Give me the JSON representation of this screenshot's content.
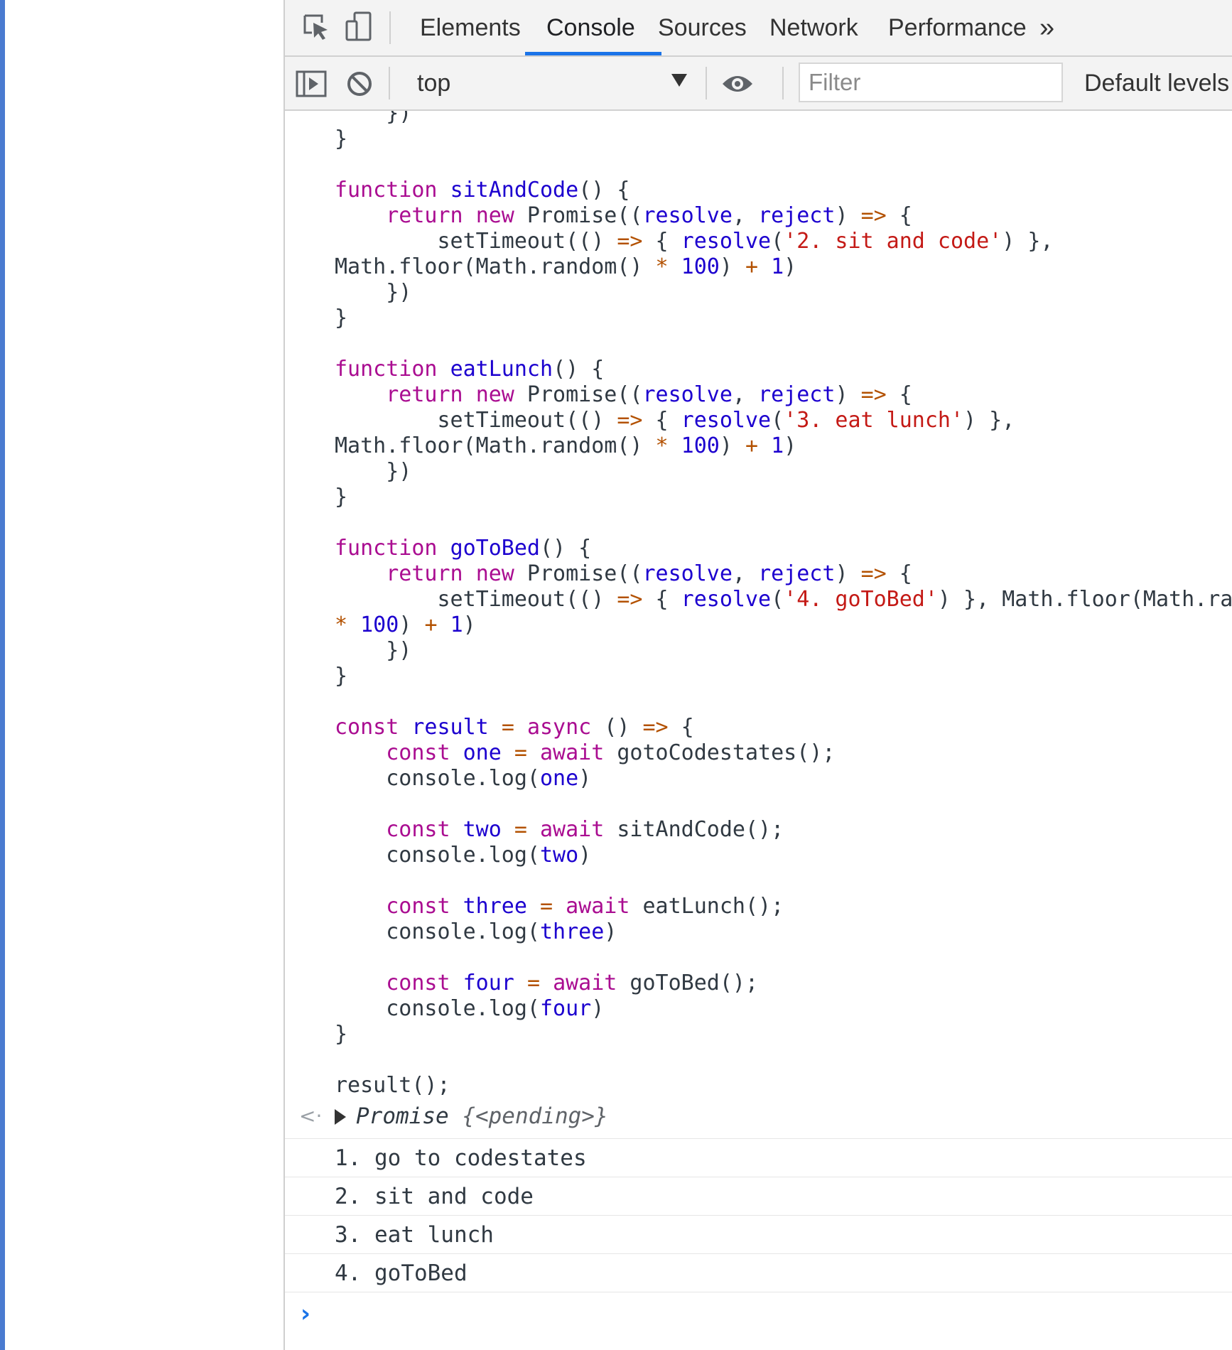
{
  "tabs": {
    "elements": "Elements",
    "console": "Console",
    "sources": "Sources",
    "network": "Network",
    "performance": "Performance",
    "more": "»"
  },
  "toolbar": {
    "context": "top",
    "filter_placeholder": "Filter",
    "levels": "Default levels"
  },
  "result": {
    "label": "Promise ",
    "state": "{<pending>}"
  },
  "logs": [
    "1. go to codestates",
    "2. sit and code",
    "3. eat lunch",
    "4. goToBed"
  ],
  "colors": {
    "accent": "#1a73e8",
    "keyword": "#aa0d91",
    "variable": "#1c00cf",
    "string": "#c41a16",
    "operator": "#b35100"
  },
  "icons": [
    "inspect-icon",
    "device-toolbar-icon",
    "sidebar-toggle-icon",
    "clear-console-icon",
    "eye-icon",
    "chevron-right-icon"
  ]
}
